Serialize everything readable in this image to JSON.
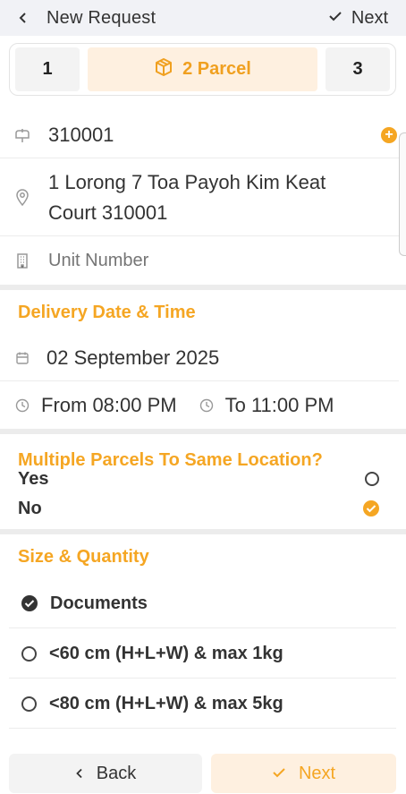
{
  "header": {
    "title": "New Request",
    "next_label": "Next",
    "back_icon": "chevron-left-icon",
    "next_icon": "check-icon"
  },
  "steps": [
    {
      "label": "1"
    },
    {
      "label": "2 Parcel",
      "active": true,
      "icon": "package-icon"
    },
    {
      "label": "3"
    }
  ],
  "location": {
    "postal_code": "310001",
    "address": "1 Lorong 7 Toa Payoh Kim Keat Court 310001",
    "unit_placeholder": "Unit Number"
  },
  "delivery": {
    "title": "Delivery Date & Time",
    "date": "02 September 2025",
    "from": "From 08:00 PM",
    "to": "To 11:00 PM"
  },
  "multiple": {
    "title": "Multiple Parcels To Same Location?",
    "yes_label": "Yes",
    "no_label": "No",
    "selected": "No"
  },
  "size": {
    "title": "Size & Quantity",
    "options": [
      {
        "label": "Documents",
        "selected": true
      },
      {
        "label": "<60 cm (H+L+W) & max 1kg",
        "selected": false
      },
      {
        "label": "<80 cm (H+L+W) & max 5kg",
        "selected": false
      }
    ]
  },
  "footer": {
    "back_label": "Back",
    "next_label": "Next"
  },
  "colors": {
    "accent": "#f5a623",
    "accent_bg": "#fef0e0",
    "header_bg": "#f1f2f6",
    "divider": "#ececec"
  }
}
